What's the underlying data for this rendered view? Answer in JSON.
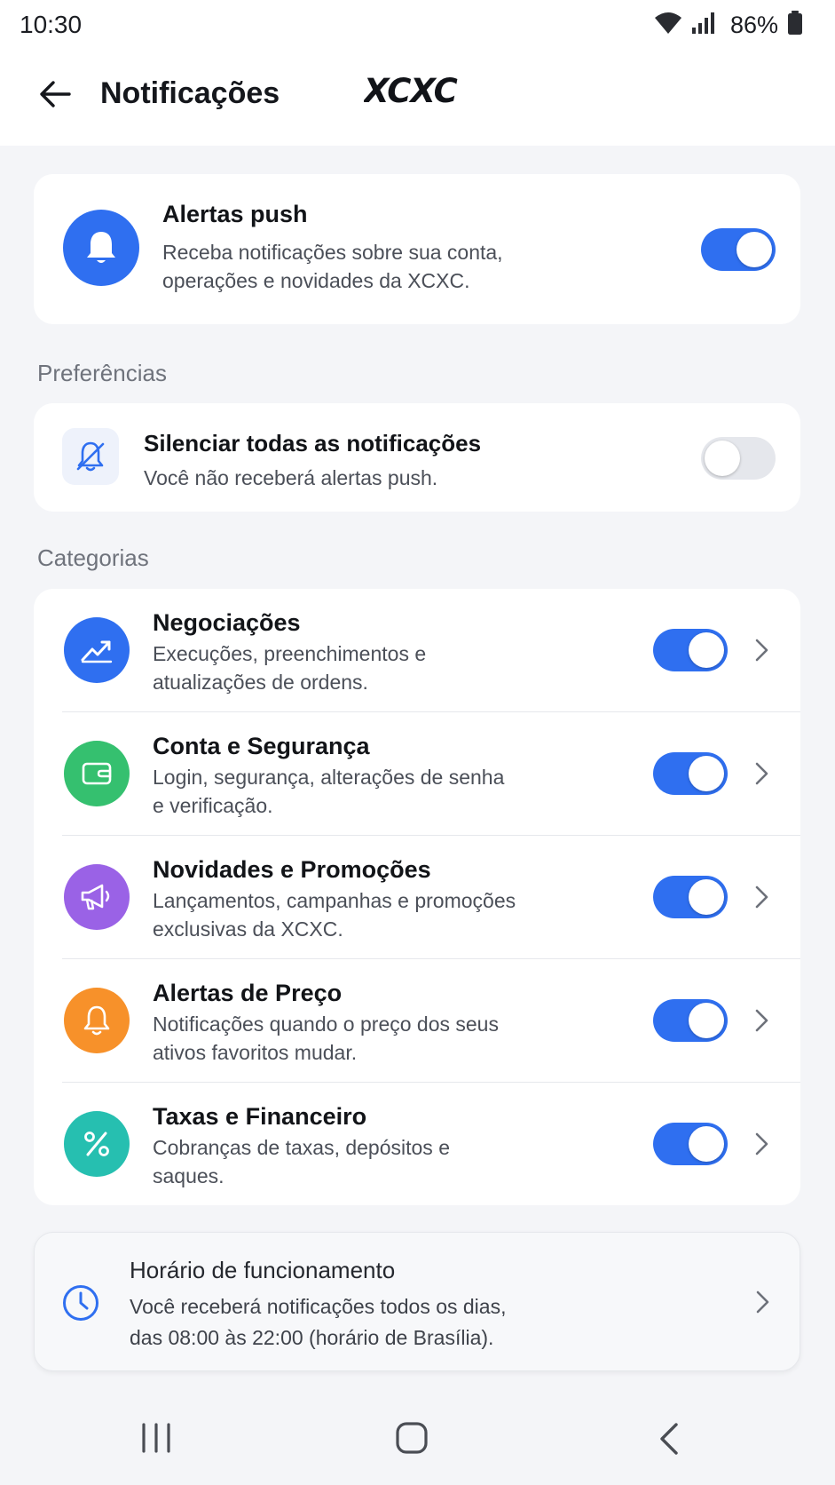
{
  "status_bar": {
    "time": "10:30",
    "battery": "86%",
    "icons": [
      "wifi-icon",
      "signal-icon",
      "battery-icon"
    ]
  },
  "header": {
    "title": "Notificações",
    "brand": "XCXC"
  },
  "push_card": {
    "title": "Alertas push",
    "description_line1": "Receba notificações sobre sua conta,",
    "description_line2": "operações e novidades da XCXC.",
    "enabled": true,
    "icon": "bell-icon"
  },
  "preferences": {
    "section_label": "Preferências",
    "mute": {
      "title": "Silenciar todas as notificações",
      "description": "Você não receberá alertas push.",
      "enabled": false,
      "icon": "bell-off-icon"
    }
  },
  "categories": {
    "section_label": "Categorias",
    "items": [
      {
        "title": "Negociações",
        "line1": "Execuções, preenchimentos e",
        "line2": "atualizações de ordens.",
        "enabled": true,
        "icon": "trending-up-icon",
        "color": "#2f6ff0"
      },
      {
        "title": "Conta e Segurança",
        "line1": "Login, segurança, alterações de senha",
        "line2": "e verificação.",
        "enabled": true,
        "icon": "wallet-icon",
        "color": "#35c06f"
      },
      {
        "title": "Novidades e Promoções",
        "line1": "Lançamentos, campanhas e promoções",
        "line2": "exclusivas da XCXC.",
        "enabled": true,
        "icon": "megaphone-icon",
        "color": "#9a62e6"
      },
      {
        "title": "Alertas de Preço",
        "line1": "Notificações quando o preço dos seus",
        "line2": "ativos favoritos mudar.",
        "enabled": true,
        "icon": "bell-icon",
        "color": "#f7912a"
      },
      {
        "title": "Taxas e Financeiro",
        "line1": "Cobranças de taxas, depósitos e",
        "line2": "saques.",
        "enabled": true,
        "icon": "percent-icon",
        "color": "#26bfb0"
      }
    ]
  },
  "schedule": {
    "title": "Horário de funcionamento",
    "line1": "Você receberá notificações todos os dias,",
    "line2": "das 08:00 às 22:00 (horário de Brasília).",
    "icon": "clock-icon"
  },
  "colors": {
    "accent": "#2f6ff0",
    "background": "#f4f5f8"
  }
}
